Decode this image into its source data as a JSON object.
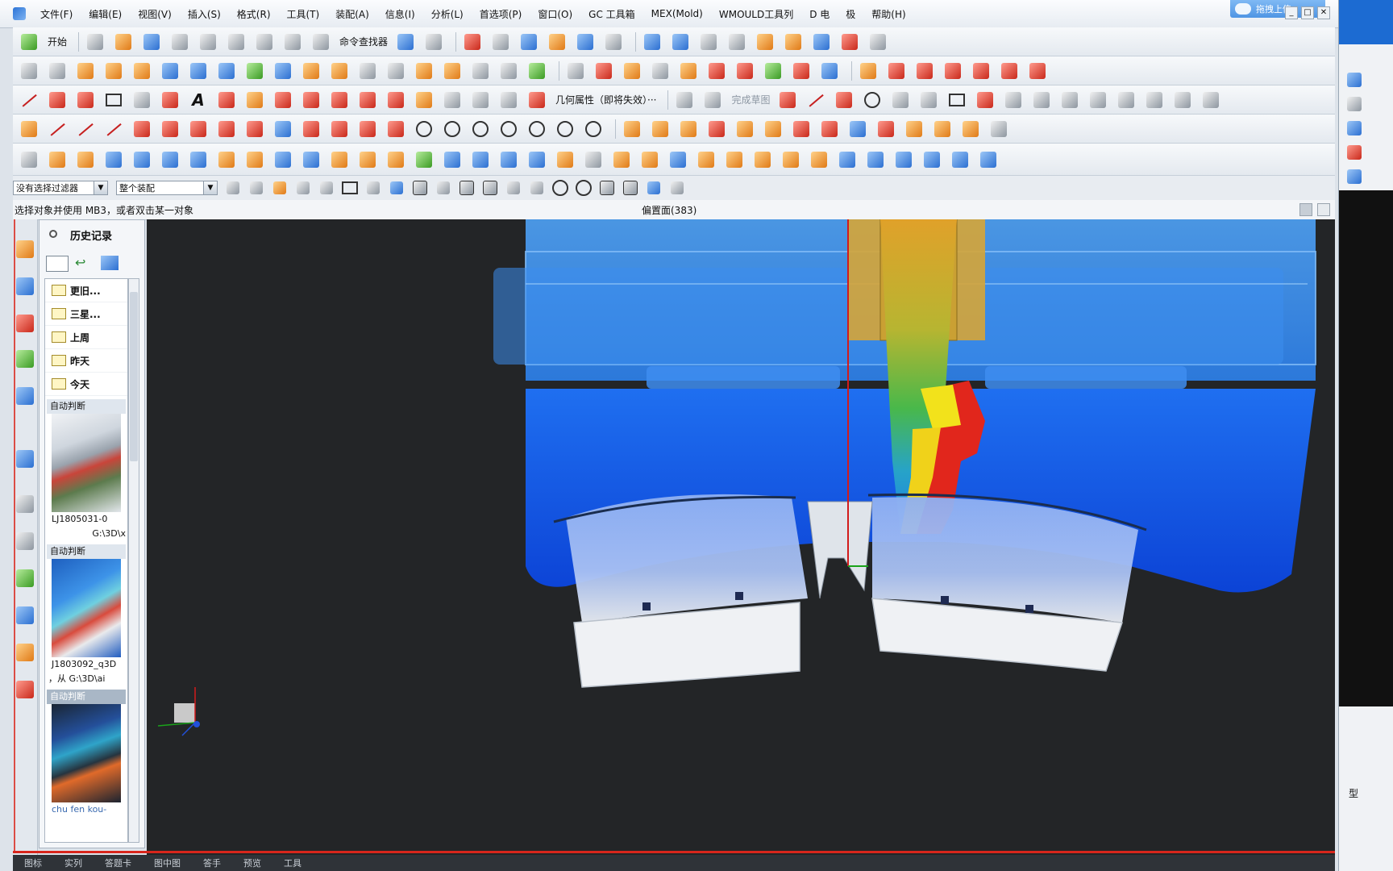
{
  "menu": {
    "items": [
      "文件(F)",
      "编辑(E)",
      "视图(V)",
      "插入(S)",
      "格式(R)",
      "工具(T)",
      "装配(A)",
      "信息(I)",
      "分析(L)",
      "首选项(P)",
      "窗口(O)",
      "GC 工具箱",
      "MEX(Mold)",
      "WMOULD工具列",
      "D 电",
      "极",
      "帮助(H)"
    ],
    "cloud_label": "拖拽上传"
  },
  "toolbar1": {
    "start_label": "开始",
    "finder_label": "命令查找器"
  },
  "toolbar3": {
    "geom_label": "几何属性（即将失效）···",
    "finish_sketch_label": "完成草图"
  },
  "selection": {
    "filter_value": "没有选择过滤器",
    "scope_value": "整个装配"
  },
  "status": {
    "prompt": "选择对象并使用 MB3，或者双击某一对象",
    "selected": "偏置面(383)"
  },
  "history": {
    "title": "历史记录",
    "folders": [
      "更旧...",
      "三星...",
      "上周",
      "昨天",
      "今天"
    ],
    "entries": [
      {
        "header": "自动判断",
        "caption1": "LJ1805031-0",
        "caption2": "G:\\3D\\x"
      },
      {
        "header": "自动判断",
        "caption1": "J1803092_q3D",
        "caption2": "，从 G:\\3D\\ai"
      },
      {
        "header": "自动判断",
        "caption1": "chu fen kou-",
        "caption2": ""
      }
    ]
  },
  "bottom_tabs": [
    "图标",
    "实列",
    "答题卡",
    "图中图",
    "答手",
    "预览",
    "工具"
  ],
  "right_window": {
    "label": "型"
  },
  "colors": {
    "viewport_bg": "#232527",
    "mold_blue": "#0f4fe0",
    "accent_red": "#d8261c"
  }
}
